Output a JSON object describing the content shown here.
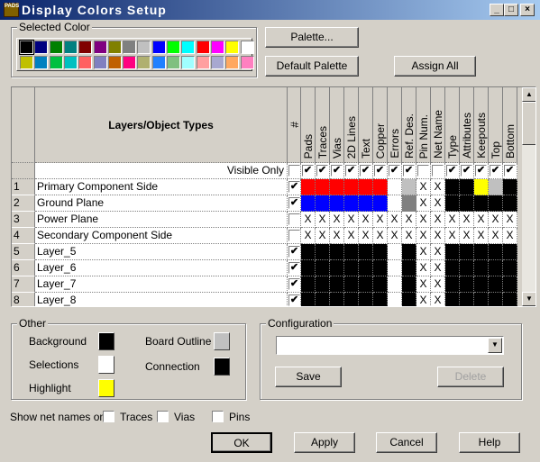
{
  "window": {
    "title": "Display Colors Setup",
    "icon_text": "PADS"
  },
  "selected_color": {
    "label": "Selected Color",
    "palette_row1": [
      "#000000",
      "#000080",
      "#008000",
      "#008080",
      "#800000",
      "#800080",
      "#808000",
      "#808080",
      "#c0c0c0",
      "#0000ff",
      "#00ff00",
      "#00ffff",
      "#ff0000",
      "#ff00ff",
      "#ffff00",
      "#ffffff"
    ],
    "palette_row2": [
      "#c0c000",
      "#0080c0",
      "#00c040",
      "#00c0c0",
      "#ff6060",
      "#8080c0",
      "#c06000",
      "#ff0080",
      "#b0b070",
      "#2080ff",
      "#80c080",
      "#a0ffff",
      "#ffa0a0",
      "#a8a8d0",
      "#ffa860",
      "#ff80c0"
    ],
    "selected": "#000000"
  },
  "buttons": {
    "palette": "Palette...",
    "default_palette": "Default Palette",
    "assign_all": "Assign All",
    "save": "Save",
    "delete": "Delete",
    "ok": "OK",
    "apply": "Apply",
    "cancel": "Cancel",
    "help": "Help"
  },
  "grid": {
    "header": "Layers/Object Types",
    "num_header": "#",
    "visible_only": "Visible Only",
    "columns": [
      "Pads",
      "Traces",
      "Vias",
      "2D Lines",
      "Text",
      "Copper",
      "Errors",
      "Ref. Des.",
      "Pin Num.",
      "Net Name",
      "Type",
      "Attributes",
      "Keepouts",
      "Top",
      "Bottom"
    ],
    "visible_only_checks": [
      false,
      true,
      true,
      true,
      true,
      true,
      true,
      true,
      true,
      false,
      false,
      true,
      true,
      true,
      true,
      true
    ],
    "color_codes": {
      "R": "#ff0000",
      "B": "#0000ff",
      "K": "#000000",
      "W": "#ffffff",
      "L": "#c0c0c0",
      "G": "#808080",
      "Y": "#ffff00"
    },
    "rows": [
      {
        "num": "1",
        "name": "Primary Component Side",
        "checked": true,
        "cells": [
          "R",
          "R",
          "R",
          "R",
          "R",
          "R",
          "W",
          "L",
          "X",
          "X",
          "K",
          "K",
          "Y",
          "L",
          "K"
        ]
      },
      {
        "num": "2",
        "name": "Ground Plane",
        "checked": true,
        "cells": [
          "B",
          "B",
          "B",
          "B",
          "B",
          "B",
          "W",
          "G",
          "X",
          "X",
          "K",
          "K",
          "K",
          "K",
          "K"
        ]
      },
      {
        "num": "3",
        "name": "Power Plane",
        "checked": false,
        "cells": [
          "X",
          "X",
          "X",
          "X",
          "X",
          "X",
          "X",
          "X",
          "X",
          "X",
          "X",
          "X",
          "X",
          "X",
          "X"
        ]
      },
      {
        "num": "4",
        "name": "Secondary Component Side",
        "checked": false,
        "cells": [
          "X",
          "X",
          "X",
          "X",
          "X",
          "X",
          "X",
          "X",
          "X",
          "X",
          "X",
          "X",
          "X",
          "X",
          "X"
        ]
      },
      {
        "num": "5",
        "name": "Layer_5",
        "checked": true,
        "cells": [
          "K",
          "K",
          "K",
          "K",
          "K",
          "K",
          "W",
          "K",
          "X",
          "X",
          "K",
          "K",
          "K",
          "K",
          "K"
        ]
      },
      {
        "num": "6",
        "name": "Layer_6",
        "checked": true,
        "cells": [
          "K",
          "K",
          "K",
          "K",
          "K",
          "K",
          "W",
          "K",
          "X",
          "X",
          "K",
          "K",
          "K",
          "K",
          "K"
        ]
      },
      {
        "num": "7",
        "name": "Layer_7",
        "checked": true,
        "cells": [
          "K",
          "K",
          "K",
          "K",
          "K",
          "K",
          "W",
          "K",
          "X",
          "X",
          "K",
          "K",
          "K",
          "K",
          "K"
        ]
      },
      {
        "num": "8",
        "name": "Layer_8",
        "checked": true,
        "cells": [
          "K",
          "K",
          "K",
          "K",
          "K",
          "K",
          "W",
          "K",
          "X",
          "X",
          "K",
          "K",
          "K",
          "K",
          "K"
        ]
      }
    ]
  },
  "other": {
    "label": "Other",
    "background": {
      "label": "Background",
      "color": "#000000"
    },
    "selections": {
      "label": "Selections",
      "color": "#ffffff"
    },
    "highlight": {
      "label": "Highlight",
      "color": "#ffff00"
    },
    "board_outline": {
      "label": "Board Outline",
      "color": "#c0c0c0"
    },
    "connection": {
      "label": "Connection",
      "color": "#000000"
    }
  },
  "configuration": {
    "label": "Configuration",
    "value": ""
  },
  "net_names": {
    "label": "Show net names on",
    "traces": "Traces",
    "vias": "Vias",
    "pins": "Pins",
    "traces_checked": false,
    "vias_checked": false,
    "pins_checked": false
  }
}
